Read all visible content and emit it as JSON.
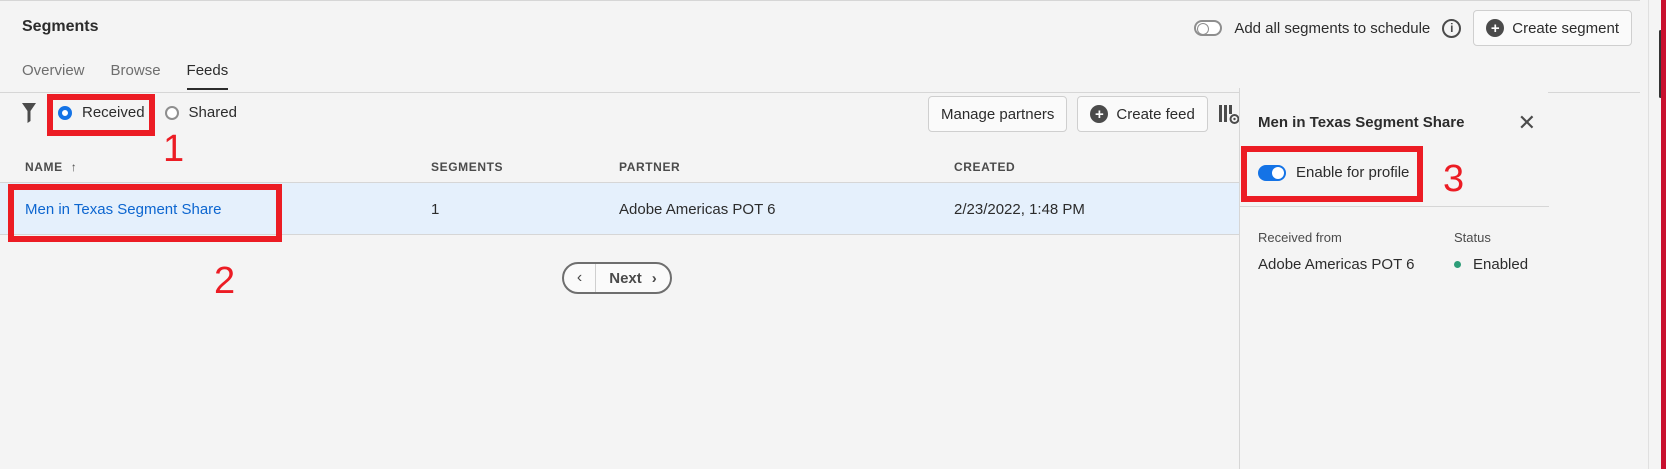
{
  "header": {
    "title": "Segments",
    "schedule_label": "Add all segments to schedule",
    "create_segment_label": "Create segment"
  },
  "tabs": [
    {
      "label": "Overview"
    },
    {
      "label": "Browse"
    },
    {
      "label": "Feeds"
    }
  ],
  "filter": {
    "received_label": "Received",
    "shared_label": "Shared",
    "selected": "Received"
  },
  "toolbar": {
    "manage_partners_label": "Manage partners",
    "create_feed_label": "Create feed"
  },
  "table": {
    "columns": [
      "NAME",
      "SEGMENTS",
      "PARTNER",
      "CREATED"
    ],
    "rows": [
      {
        "name": "Men in Texas Segment Share",
        "segments": "1",
        "partner": "Adobe Americas POT 6",
        "created": "2/23/2022, 1:48 PM"
      }
    ]
  },
  "pagination": {
    "next_label": "Next"
  },
  "panel": {
    "title": "Men in Texas Segment Share",
    "toggle_label": "Enable for profile",
    "received_from_label": "Received from",
    "received_from_value": "Adobe Americas POT 6",
    "status_label": "Status",
    "status_value": "Enabled"
  },
  "annotations": [
    "1",
    "2",
    "3"
  ],
  "colors": {
    "accent": "#1473e6",
    "link": "#0d66d0",
    "annotation": "#ec1c24",
    "status_enabled": "#2d9d78",
    "row_selected": "#e5f0fc"
  }
}
